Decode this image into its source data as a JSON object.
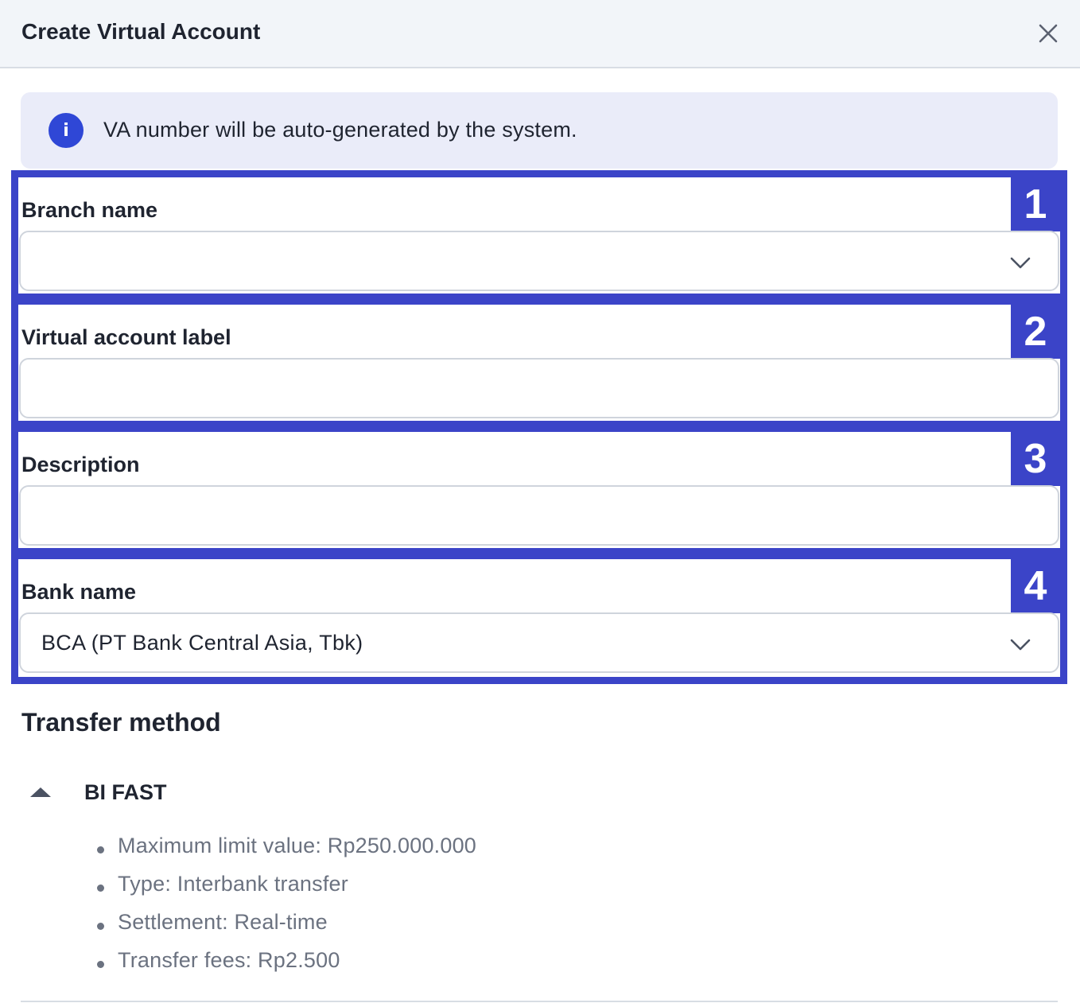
{
  "dialog": {
    "title": "Create Virtual Account",
    "close_icon": "close-icon"
  },
  "info": {
    "icon": "info-icon",
    "icon_glyph": "i",
    "text": "VA number will be auto-generated by the system."
  },
  "fields": [
    {
      "badge": "1",
      "label": "Branch name",
      "type": "select",
      "value": "",
      "chevron_icon": "chevron-down-icon"
    },
    {
      "badge": "2",
      "label": "Virtual account label",
      "type": "text",
      "value": ""
    },
    {
      "badge": "3",
      "label": "Description",
      "type": "text",
      "value": ""
    },
    {
      "badge": "4",
      "label": "Bank name",
      "type": "select",
      "value": "BCA (PT Bank Central Asia, Tbk)",
      "chevron_icon": "chevron-down-icon"
    }
  ],
  "transfer": {
    "title": "Transfer method",
    "method": {
      "label": "BI FAST",
      "toggle_icon": "caret-up-icon",
      "details": [
        "Maximum limit value: Rp250.000.000",
        "Type: Interbank transfer",
        "Settlement: Real-time",
        "Transfer fees: Rp2.500"
      ]
    }
  },
  "colors": {
    "highlight": "#3b44c8",
    "info_bg": "#eaecf9",
    "info_icon": "#2f47d6",
    "header_bg": "#f2f5f9"
  }
}
